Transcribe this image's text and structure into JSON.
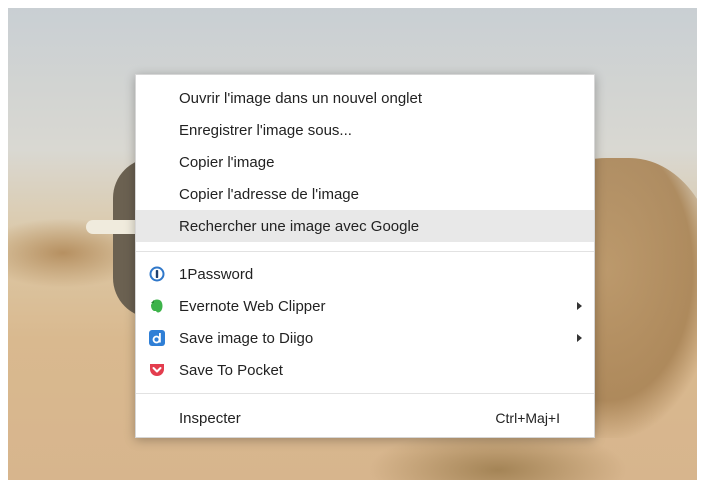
{
  "menu": {
    "items": [
      {
        "label": "Ouvrir l'image dans un nouvel onglet"
      },
      {
        "label": "Enregistrer l'image sous..."
      },
      {
        "label": "Copier l'image"
      },
      {
        "label": "Copier l'adresse de l'image"
      },
      {
        "label": "Rechercher une image avec Google"
      }
    ],
    "extensions": [
      {
        "label": "1Password",
        "icon": "1password-icon",
        "color": "#2f77c9"
      },
      {
        "label": "Evernote Web Clipper",
        "icon": "evernote-icon",
        "color": "#3db34a"
      },
      {
        "label": "Save image to Diigo",
        "icon": "diigo-icon",
        "color": "#2f7fd6"
      },
      {
        "label": "Save To Pocket",
        "icon": "pocket-icon",
        "color": "#e33d4e"
      }
    ],
    "inspect": {
      "label": "Inspecter",
      "shortcut": "Ctrl+Maj+I"
    }
  },
  "colors": {
    "hover": "#e8e8e8",
    "menu_bg": "#ffffff"
  }
}
